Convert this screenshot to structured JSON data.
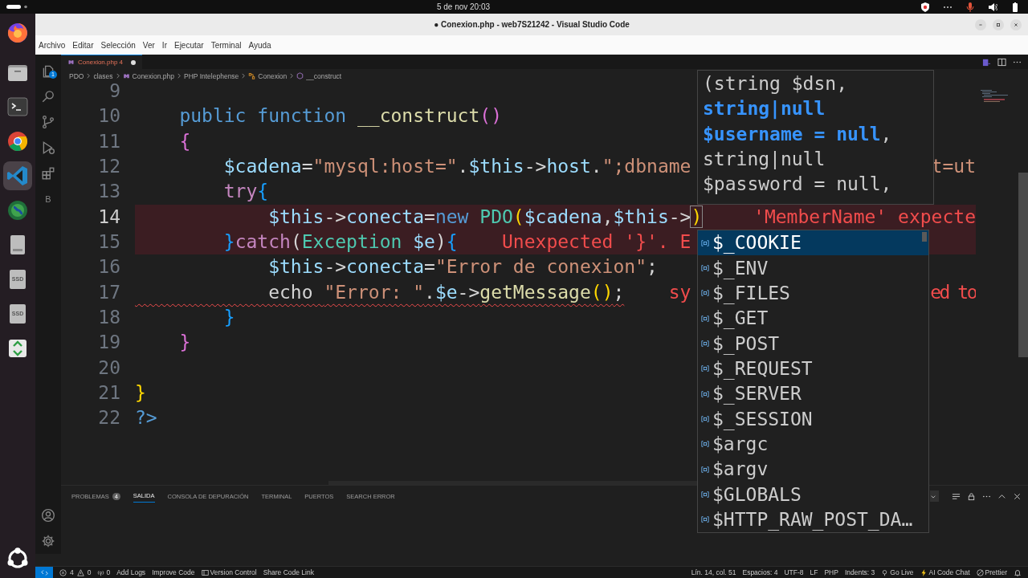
{
  "topbar": {
    "datetime": "5 de nov  20:03"
  },
  "dock": [
    {
      "kind": "firefox",
      "selected": false
    },
    {
      "kind": "files",
      "selected": false
    },
    {
      "kind": "terminal",
      "selected": false
    },
    {
      "kind": "chrome",
      "selected": false
    },
    {
      "kind": "vscode",
      "selected": true
    },
    {
      "kind": "globe",
      "selected": false
    },
    {
      "kind": "drive",
      "selected": false
    },
    {
      "kind": "ssd",
      "label": "SSD",
      "selected": false
    },
    {
      "kind": "ssd",
      "label": "SSD",
      "selected": false
    },
    {
      "kind": "trash",
      "selected": false
    }
  ],
  "window": {
    "title": "● Conexion.php - web7S21242 - Visual Studio Code"
  },
  "menu": [
    "Archivo",
    "Editar",
    "Selección",
    "Ver",
    "Ir",
    "Ejecutar",
    "Terminal",
    "Ayuda"
  ],
  "activity_bar": {
    "items": [
      {
        "kind": "explorer",
        "badge": "1"
      },
      {
        "kind": "search"
      },
      {
        "kind": "source-control"
      },
      {
        "kind": "run"
      },
      {
        "kind": "extensions"
      },
      {
        "kind": "letter",
        "label": "B"
      }
    ],
    "bottom": [
      {
        "kind": "account"
      },
      {
        "kind": "settings"
      }
    ]
  },
  "tab": {
    "label": "Conexion.php",
    "problems": "4",
    "modified": true,
    "selected": true
  },
  "breadcrumbs": [
    {
      "label": "PDO",
      "kind": "folder"
    },
    {
      "label": "clases",
      "kind": "folder"
    },
    {
      "label": "Conexion.php",
      "kind": "php-file"
    },
    {
      "label": "PHP Intelephense",
      "kind": "folder"
    },
    {
      "label": "Conexion",
      "kind": "class"
    },
    {
      "label": "__construct",
      "kind": "method"
    }
  ],
  "editor": {
    "lines": [
      {
        "number": "9",
        "current": false
      },
      {
        "number": "10",
        "current": false,
        "tokens": [
          {
            "text": "    public",
            "kind": "kw"
          },
          {
            "text": " function ",
            "kind": "kw"
          },
          {
            "text": "__construct",
            "kind": "fn"
          },
          {
            "text": "()",
            "kind": "b2"
          }
        ]
      },
      {
        "number": "11",
        "current": false,
        "tokens": [
          {
            "text": "    {",
            "kind": "b2"
          }
        ]
      },
      {
        "number": "12",
        "current": false,
        "tokens": [
          {
            "text": "        $cadena",
            "kind": "var"
          },
          {
            "text": "=",
            "kind": "op"
          },
          {
            "text": "\"mysql:host=\"",
            "kind": "str"
          },
          {
            "text": ".",
            "kind": "op"
          },
          {
            "text": "$this",
            "kind": "var"
          },
          {
            "text": "->",
            "kind": "op"
          },
          {
            "text": "host",
            "kind": "var"
          },
          {
            "text": ".",
            "kind": "op"
          },
          {
            "text": "\";dbname",
            "kind": "str"
          }
        ],
        "tail": {
          "text": "t=ut",
          "kind": "str"
        }
      },
      {
        "number": "13",
        "current": false,
        "tokens": [
          {
            "text": "        try",
            "kind": "ctl"
          },
          {
            "text": "{",
            "kind": "b3"
          }
        ]
      },
      {
        "number": "14",
        "current": true,
        "error_band": true,
        "tokens": [
          {
            "text": "            $this",
            "kind": "var"
          },
          {
            "text": "->",
            "kind": "op"
          },
          {
            "text": "conecta",
            "kind": "var"
          },
          {
            "text": "=",
            "kind": "op"
          },
          {
            "text": "new ",
            "kind": "kw"
          },
          {
            "text": "PDO",
            "kind": "cls"
          },
          {
            "text": "(",
            "kind": "b1"
          },
          {
            "text": "$cadena",
            "kind": "var"
          },
          {
            "text": ",",
            "kind": "op"
          },
          {
            "text": "$this",
            "kind": "var"
          },
          {
            "text": "->",
            "kind": "op"
          },
          {
            "text": ")",
            "kind": "b1",
            "matched": true
          }
        ],
        "tail": {
          "text": "'MemberName' expecte",
          "kind": "err"
        }
      },
      {
        "number": "15",
        "current": false,
        "error_band": true,
        "tokens": [
          {
            "text": "        }",
            "kind": "b3"
          },
          {
            "text": "catch",
            "kind": "ctl"
          },
          {
            "text": "(",
            "kind": "op"
          },
          {
            "text": "Exception",
            "kind": "cls"
          },
          {
            "text": " $e",
            "kind": "var"
          },
          {
            "text": ")",
            "kind": "op"
          },
          {
            "text": "{",
            "kind": "b3"
          }
        ],
        "inline": {
          "text": "Unexpected '}'. E",
          "kind": "err"
        }
      },
      {
        "number": "16",
        "current": false,
        "tokens": [
          {
            "text": "            $this",
            "kind": "var"
          },
          {
            "text": "->",
            "kind": "op"
          },
          {
            "text": "conecta",
            "kind": "var"
          },
          {
            "text": "=",
            "kind": "op"
          },
          {
            "text": "\"Error de conexion\"",
            "kind": "str"
          },
          {
            "text": ";",
            "kind": "op"
          }
        ]
      },
      {
        "number": "17",
        "current": false,
        "squiggle": true,
        "tokens": [
          {
            "text": "            echo ",
            "kind": "op"
          },
          {
            "text": "\"Error: \"",
            "kind": "str"
          },
          {
            "text": ".",
            "kind": "op"
          },
          {
            "text": "$e",
            "kind": "var"
          },
          {
            "text": "->",
            "kind": "op"
          },
          {
            "text": "getMessage",
            "kind": "fn"
          },
          {
            "text": "()",
            "kind": "b1"
          },
          {
            "text": ";",
            "kind": "op"
          }
        ],
        "inline": {
          "text": "sy",
          "kind": "err"
        },
        "tail": {
          "text": "ed to",
          "kind": "err"
        }
      },
      {
        "number": "18",
        "current": false,
        "tokens": [
          {
            "text": "        }",
            "kind": "b3"
          }
        ]
      },
      {
        "number": "19",
        "current": false,
        "tokens": [
          {
            "text": "    }",
            "kind": "b2"
          }
        ]
      },
      {
        "number": "20",
        "current": false
      },
      {
        "number": "21",
        "current": false,
        "tokens": [
          {
            "text": "}",
            "kind": "b1"
          }
        ]
      },
      {
        "number": "22",
        "current": false,
        "tokens": [
          {
            "text": "?>",
            "kind": "kw"
          }
        ]
      }
    ]
  },
  "signature_help": {
    "lines": [
      "(string $dsn,",
      "**string|null**",
      "**$username = null**,",
      "string|null",
      "$password = null,"
    ]
  },
  "suggestions": [
    {
      "label": "$_COOKIE",
      "selected": true
    },
    {
      "label": "$_ENV",
      "selected": false
    },
    {
      "label": "$_FILES",
      "selected": false
    },
    {
      "label": "$_GET",
      "selected": false
    },
    {
      "label": "$_POST",
      "selected": false
    },
    {
      "label": "$_REQUEST",
      "selected": false
    },
    {
      "label": "$_SERVER",
      "selected": false
    },
    {
      "label": "$_SESSION",
      "selected": false
    },
    {
      "label": "$argc",
      "selected": false
    },
    {
      "label": "$argv",
      "selected": false
    },
    {
      "label": "$GLOBALS",
      "selected": false
    },
    {
      "label": "$HTTP_RAW_POST_DA…",
      "selected": false
    }
  ],
  "panel": {
    "tabs": [
      {
        "label": "PROBLEMAS",
        "badge": "4",
        "selected": false
      },
      {
        "label": "SALIDA",
        "selected": true
      },
      {
        "label": "CONSOLA DE DEPURACIÓN",
        "selected": false
      },
      {
        "label": "TERMINAL",
        "selected": false
      },
      {
        "label": "PUERTOS",
        "selected": false
      },
      {
        "label": "SEARCH ERROR",
        "selected": false
      }
    ]
  },
  "status_bar": {
    "errors": "4",
    "warnings": "0",
    "ports": "0",
    "left": [
      {
        "text": "Add Logs",
        "kind": "plain"
      },
      {
        "text": "Improve Code",
        "kind": "plain"
      },
      {
        "text": "Version Control",
        "kind": "vcs"
      },
      {
        "text": "Share Code Link",
        "kind": "plain"
      }
    ],
    "right": [
      {
        "text": "Lín. 14, col. 51",
        "kind": "plain"
      },
      {
        "text": "Espacios: 4",
        "kind": "plain"
      },
      {
        "text": "UTF-8",
        "kind": "plain"
      },
      {
        "text": "LF",
        "kind": "plain"
      },
      {
        "text": "PHP",
        "kind": "plain"
      },
      {
        "text": "Indents: 3",
        "kind": "plain"
      },
      {
        "text": "Go Live",
        "kind": "golive"
      },
      {
        "text": "AI Code Chat",
        "kind": "bolt"
      },
      {
        "text": "Prettier",
        "kind": "prettier"
      }
    ]
  }
}
